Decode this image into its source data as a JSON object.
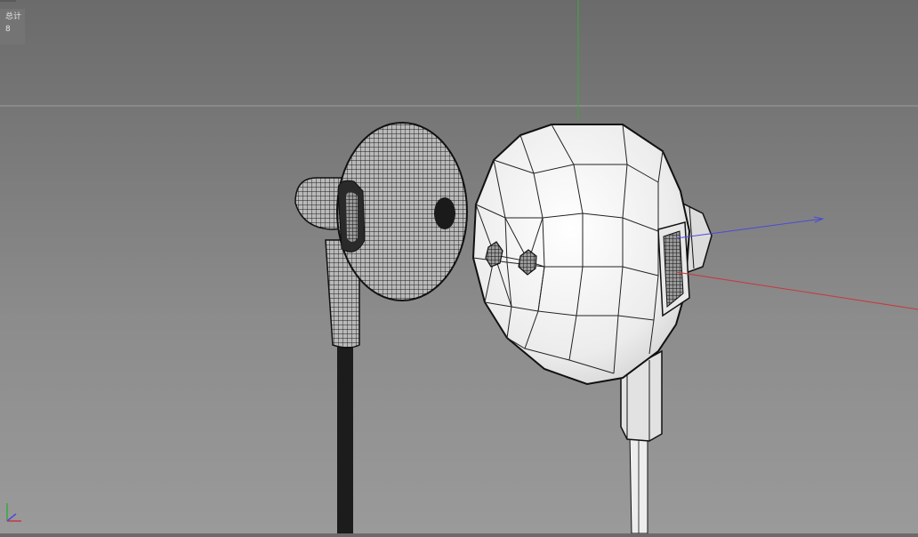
{
  "viewport": {
    "stats": {
      "label": "总计",
      "value": "8"
    },
    "axis_colors": {
      "x": "#c8383f",
      "y": "#3fa63f",
      "z": "#4b4bd8"
    },
    "gizmo_icon": "xyz-axis-gizmo-icon",
    "objects": [
      "earphone-hi-res-wireframe",
      "earphone-low-poly-wireframe"
    ]
  }
}
